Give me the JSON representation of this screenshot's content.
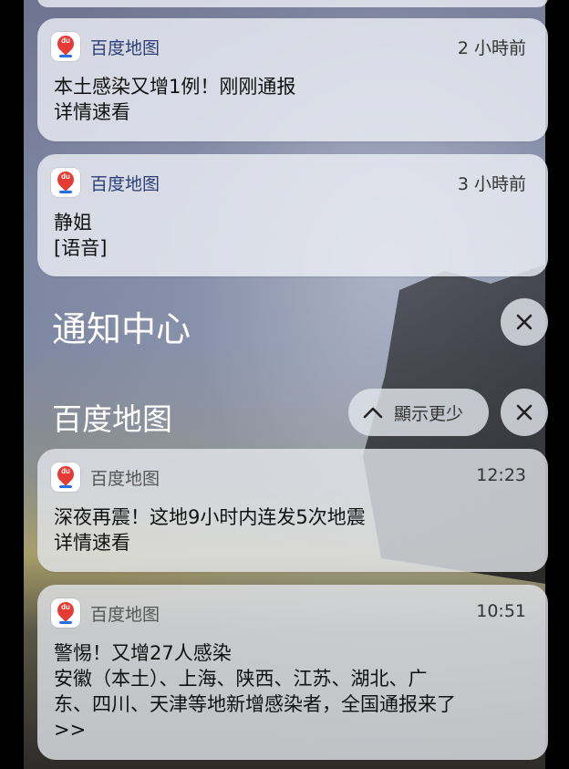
{
  "notifications_top": [
    {
      "app": "百度地图",
      "time": "2 小時前",
      "lines": [
        "本土感染又增1例！刚刚通报",
        "详情速看"
      ]
    },
    {
      "app": "百度地图",
      "time": "3 小時前",
      "lines": [
        "静姐",
        "[语音]"
      ]
    }
  ],
  "notification_center": {
    "title": "通知中心",
    "close_icon": "close-icon"
  },
  "app_group": {
    "title": "百度地图",
    "show_less_label": "顯示更少",
    "chevron_icon": "chevron-up-icon",
    "close_icon": "close-icon"
  },
  "notifications_group": [
    {
      "app": "百度地图",
      "time": "12:23",
      "lines": [
        "深夜再震！这地9小时内连发5次地震",
        "详情速看"
      ]
    },
    {
      "app": "百度地图",
      "time": "10:51",
      "lines": [
        "警惕！又增27人感染",
        "安徽（本土）、上海、陕西、江苏、湖北、广",
        "东、四川、天津等地新增感染者，全国通报来了",
        ">>"
      ]
    }
  ],
  "colors": {
    "card_bg": "#eceef4",
    "app_name": "#2b3e75",
    "icon_red": "#e53b34"
  }
}
